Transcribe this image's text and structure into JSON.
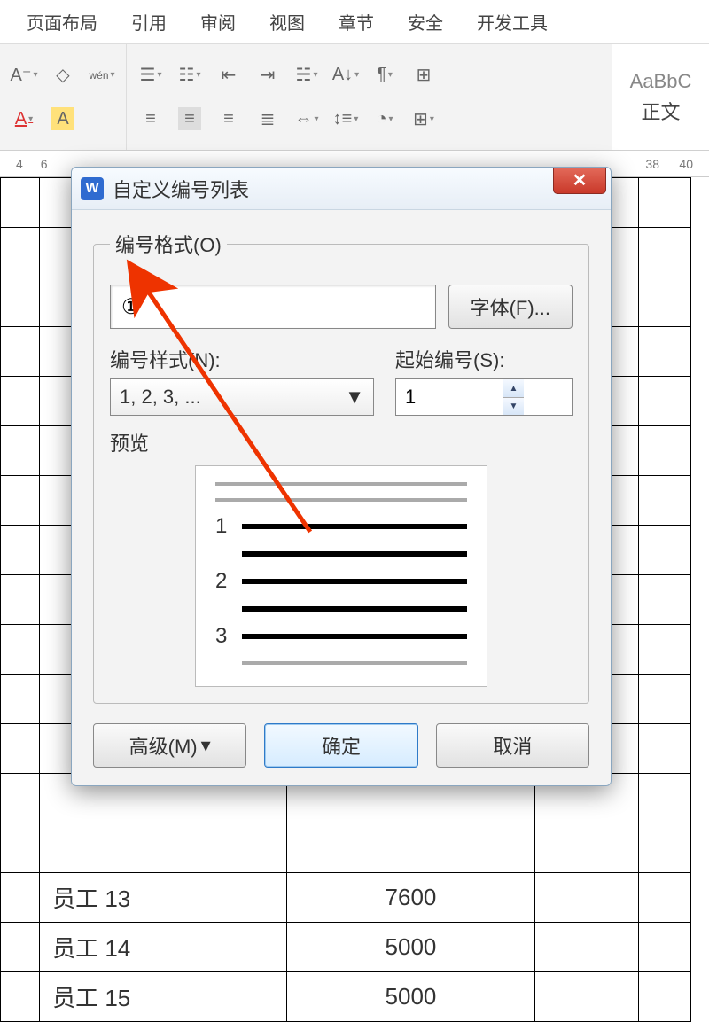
{
  "menu": {
    "items": [
      "页面布局",
      "引用",
      "审阅",
      "视图",
      "章节",
      "安全",
      "开发工具"
    ]
  },
  "ribbon": {
    "style_sample": "AaBbC",
    "style_name": "正文"
  },
  "ruler": {
    "marks": [
      "4",
      "6",
      "38",
      "40"
    ]
  },
  "dialog": {
    "title": "自定义编号列表",
    "format_group": "编号格式(O)",
    "format_value": "①",
    "font_btn": "字体(F)...",
    "style_label": "编号样式(N):",
    "style_value": "1, 2, 3, ...",
    "start_label": "起始编号(S):",
    "start_value": "1",
    "preview_label": "预览",
    "preview_numbers": [
      "1",
      "2",
      "3"
    ],
    "advanced_btn": "高级(M) ",
    "ok_btn": "确定",
    "cancel_btn": "取消"
  },
  "table": {
    "rows": [
      {
        "name": "员工 13",
        "value": "7600"
      },
      {
        "name": "员工 14",
        "value": "5000"
      },
      {
        "name": "员工 15",
        "value": "5000"
      }
    ]
  }
}
